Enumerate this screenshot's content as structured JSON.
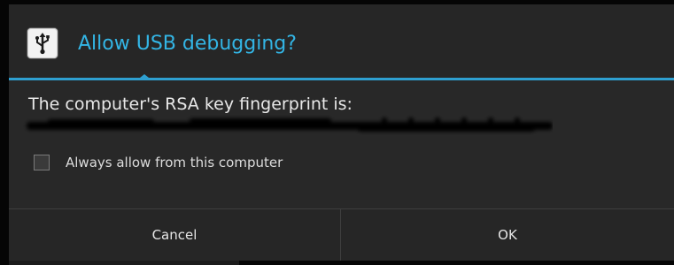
{
  "dialog": {
    "title": "Allow USB debugging?",
    "message": "The computer's RSA key fingerprint is:",
    "fingerprint_redacted": true,
    "checkbox": {
      "label": "Always allow from this computer",
      "checked": false
    },
    "buttons": {
      "cancel_label": "Cancel",
      "ok_label": "OK"
    },
    "icon": "usb-icon"
  },
  "colors": {
    "accent": "#33b5e5",
    "dialog_bg": "#282828",
    "text": "#e8e8e8"
  }
}
